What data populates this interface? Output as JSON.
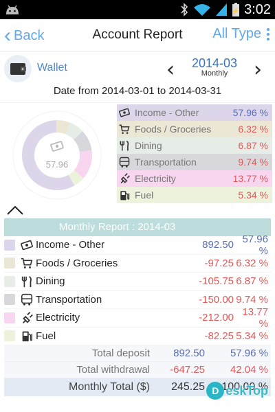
{
  "status_bar": {
    "time": "3:02"
  },
  "action_bar": {
    "back_label": "Back",
    "title": "Account Report",
    "filter_label": "All Type"
  },
  "account": {
    "name": "Wallet",
    "period": "2014-03",
    "period_type": "Monthly"
  },
  "date_range": "Date from 2014-03-01 to 2014-03-31",
  "chart_center_label": "57.96",
  "chart_data": {
    "type": "pie",
    "categories": [
      "Income - Other",
      "Foods / Groceries",
      "Dining",
      "Transportation",
      "Electricity",
      "Fuel"
    ],
    "values": [
      57.96,
      6.32,
      6.87,
      9.74,
      13.77,
      5.34
    ],
    "colors": [
      "#ddd6ea",
      "#ece7d4",
      "#e6ece6",
      "#d8d8dc",
      "#f8d6ef",
      "#edf2dc"
    ]
  },
  "legend": [
    {
      "name": "Income - Other",
      "pct": "57.96 %",
      "bg": "#ddd6ea",
      "pct_color": "#5a6eb8",
      "icon": "money-icon"
    },
    {
      "name": "Foods / Groceries",
      "pct": "6.32 %",
      "bg": "#ece7d4",
      "pct_color": "#e05a5a",
      "icon": "cart-icon"
    },
    {
      "name": "Dining",
      "pct": "6.87 %",
      "bg": "#e6ece6",
      "pct_color": "#e05a5a",
      "icon": "utensils-icon"
    },
    {
      "name": "Transportation",
      "pct": "9.74 %",
      "bg": "#d8d8dc",
      "pct_color": "#e05a5a",
      "icon": "bus-icon"
    },
    {
      "name": "Electricity",
      "pct": "13.77 %",
      "bg": "#f8d6ef",
      "pct_color": "#e05a5a",
      "icon": "plug-icon"
    },
    {
      "name": "Fuel",
      "pct": "5.34 %",
      "bg": "#edf2dc",
      "pct_color": "#e05a5a",
      "icon": "fuel-icon"
    }
  ],
  "report": {
    "header": "Monthly Report : 2014-03",
    "rows": [
      {
        "name": "Income - Other",
        "amount": "892.50",
        "pct": "57.96 %",
        "swatch": "#ddd6ea",
        "amount_color": "#5a6eb8",
        "pct_color": "#5a6eb8",
        "icon": "money-icon"
      },
      {
        "name": "Foods / Groceries",
        "amount": "-97.25",
        "pct": "6.32 %",
        "swatch": "#ece7d4",
        "amount_color": "#e05a5a",
        "pct_color": "#e05a5a",
        "icon": "cart-icon"
      },
      {
        "name": "Dining",
        "amount": "-105.75",
        "pct": "6.87 %",
        "swatch": "#e6ece6",
        "amount_color": "#e05a5a",
        "pct_color": "#e05a5a",
        "icon": "utensils-icon"
      },
      {
        "name": "Transportation",
        "amount": "-150.00",
        "pct": "9.74 %",
        "swatch": "#d8d8dc",
        "amount_color": "#e05a5a",
        "pct_color": "#e05a5a",
        "icon": "bus-icon"
      },
      {
        "name": "Electricity",
        "amount": "-212.00",
        "pct": "13.77 %",
        "swatch": "#f8d6ef",
        "amount_color": "#e05a5a",
        "pct_color": "#e05a5a",
        "icon": "plug-icon"
      },
      {
        "name": "Fuel",
        "amount": "-82.25",
        "pct": "5.34 %",
        "swatch": "#edf2dc",
        "amount_color": "#e05a5a",
        "pct_color": "#e05a5a",
        "icon": "fuel-icon"
      }
    ],
    "total_deposit": {
      "label": "Total deposit",
      "amount": "892.50",
      "pct": "57.96 %"
    },
    "total_withdrawal": {
      "label": "Total withdrawal",
      "amount": "-647.25",
      "pct": "42.04 %"
    },
    "monthly_total": {
      "label": "Monthly Total ($)",
      "amount": "245.25",
      "pct": "100.00 %"
    }
  },
  "watermark": {
    "text": "eskTop",
    "letter": "D"
  },
  "colors": {
    "accent": "#62a8e6",
    "income": "#5a6eb8",
    "expense": "#e05a5a",
    "report_header": "#bcdddb"
  }
}
